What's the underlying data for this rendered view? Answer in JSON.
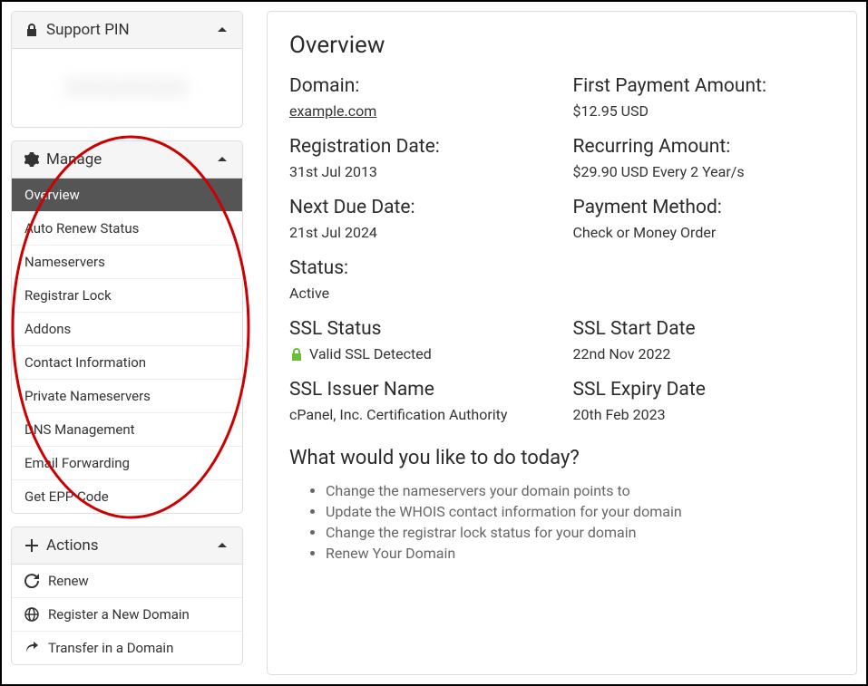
{
  "sidebar": {
    "support_pin": {
      "title": "Support PIN",
      "value_masked": "XXXXXXXX"
    },
    "manage": {
      "title": "Manage",
      "items": [
        {
          "label": "Overview",
          "active": true
        },
        {
          "label": "Auto Renew Status",
          "active": false
        },
        {
          "label": "Nameservers",
          "active": false
        },
        {
          "label": "Registrar Lock",
          "active": false
        },
        {
          "label": "Addons",
          "active": false
        },
        {
          "label": "Contact Information",
          "active": false
        },
        {
          "label": "Private Nameservers",
          "active": false
        },
        {
          "label": "DNS Management",
          "active": false
        },
        {
          "label": "Email Forwarding",
          "active": false
        },
        {
          "label": "Get EPP Code",
          "active": false
        }
      ]
    },
    "actions": {
      "title": "Actions",
      "items": [
        {
          "label": "Renew",
          "icon": "refresh-icon"
        },
        {
          "label": "Register a New Domain",
          "icon": "globe-icon"
        },
        {
          "label": "Transfer in a Domain",
          "icon": "share-icon"
        }
      ]
    }
  },
  "overview": {
    "heading": "Overview",
    "domain_label": "Domain:",
    "domain_value": "example.com",
    "first_payment_label": "First Payment Amount:",
    "first_payment_value": "$12.95 USD",
    "reg_date_label": "Registration Date:",
    "reg_date_value": "31st Jul 2013",
    "recurring_label": "Recurring Amount:",
    "recurring_value": "$29.90 USD Every 2 Year/s",
    "due_date_label": "Next Due Date:",
    "due_date_value": "21st Jul 2024",
    "payment_method_label": "Payment Method:",
    "payment_method_value": "Check or Money Order",
    "status_label": "Status:",
    "status_value": "Active",
    "ssl_status_label": "SSL Status",
    "ssl_status_value": "Valid SSL Detected",
    "ssl_start_label": "SSL Start Date",
    "ssl_start_value": "22nd Nov 2022",
    "ssl_issuer_label": "SSL Issuer Name",
    "ssl_issuer_value": "cPanel, Inc. Certification Authority",
    "ssl_expiry_label": "SSL Expiry Date",
    "ssl_expiry_value": "20th Feb 2023",
    "prompt": "What would you like to do today?",
    "todo": [
      "Change the nameservers your domain points to",
      "Update the WHOIS contact information for your domain",
      "Change the registrar lock status for your domain",
      "Renew Your Domain"
    ]
  }
}
